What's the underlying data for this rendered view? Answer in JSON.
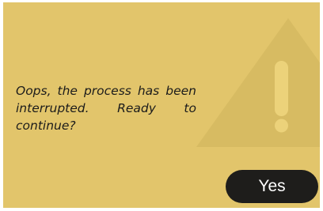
{
  "dialog": {
    "message": "Oops, the process has been interrupted. Ready to continue?",
    "confirm_label": "Yes",
    "icon": "warning-icon"
  },
  "colors": {
    "panel": "#e2c56b",
    "warning_triangle": "#d7bb62",
    "warning_mark": "#ecd27a",
    "button": "#1e1d1b",
    "button_text": "#ffffff",
    "message_text": "#1b1b1b"
  }
}
